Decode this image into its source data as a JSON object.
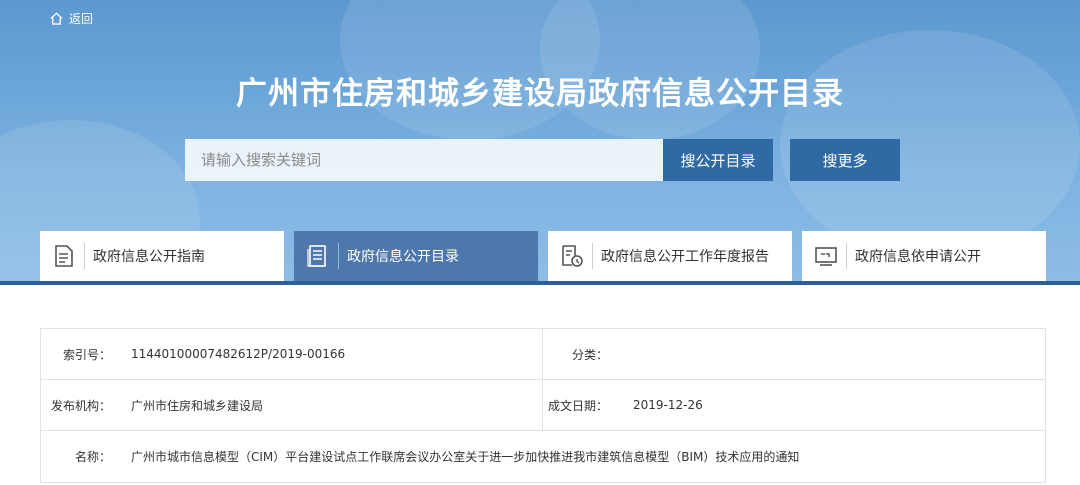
{
  "header": {
    "back_label": "返回",
    "title": "广州市住房和城乡建设局政府信息公开目录"
  },
  "search": {
    "placeholder": "请输入搜索关键词",
    "search_button": "搜公开目录",
    "more_button": "搜更多"
  },
  "tabs": [
    {
      "label": "政府信息公开指南",
      "icon": "document-list-icon",
      "active": false
    },
    {
      "label": "政府信息公开目录",
      "icon": "catalog-icon",
      "active": true
    },
    {
      "label": "政府信息公开工作年度报告",
      "icon": "report-icon",
      "active": false
    },
    {
      "label": "政府信息依申请公开",
      "icon": "application-icon",
      "active": false
    }
  ],
  "meta": {
    "index_label": "索引号：",
    "index_value": "11440100007482612P/2019-00166",
    "category_label": "分类：",
    "category_value": "",
    "publisher_label": "发布机构：",
    "publisher_value": "广州市住房和城乡建设局",
    "date_label": "成文日期：",
    "date_value": "2019-12-26",
    "name_label": "名称：",
    "name_value": "广州市城市信息模型（CIM）平台建设试点工作联席会议办公室关于进一步加快推进我市建筑信息模型（BIM）技术应用的通知"
  },
  "colors": {
    "hero_blue": "#6aa4d8",
    "button_blue": "#2f6aa5",
    "active_tab": "#4e77ab"
  }
}
